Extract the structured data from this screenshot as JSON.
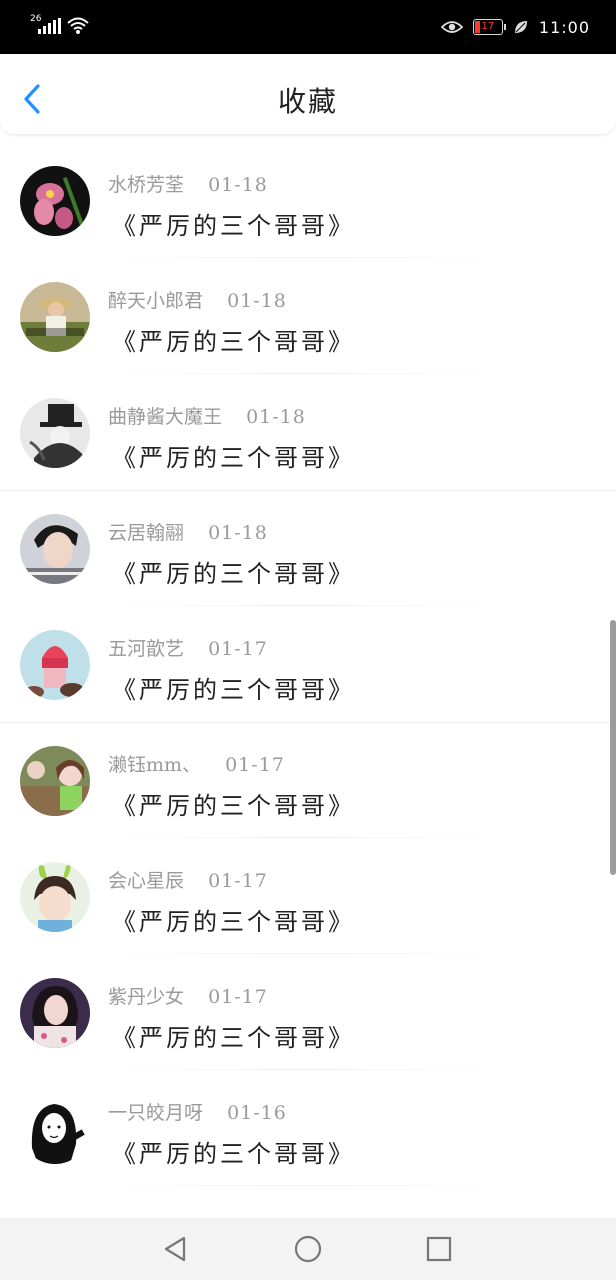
{
  "status_bar": {
    "network": "26",
    "battery": "17",
    "time": "11:00"
  },
  "header": {
    "title": "收藏"
  },
  "favorites": [
    {
      "name": "水桥芳荃",
      "date": "01-18",
      "work": "《严厉的三个哥哥》",
      "avatar": "orchid-flower"
    },
    {
      "name": "醉天小郎君",
      "date": "01-18",
      "work": "《严厉的三个哥哥》",
      "avatar": "field-hat-girl"
    },
    {
      "name": "曲静酱大魔王",
      "date": "01-18",
      "work": "《严厉的三个哥哥》",
      "avatar": "bw-top-hat"
    },
    {
      "name": "云居翰翮",
      "date": "01-18",
      "work": "《严厉的三个哥哥》",
      "avatar": "boy-portrait"
    },
    {
      "name": "五河歆艺",
      "date": "01-17",
      "work": "《严厉的三个哥哥》",
      "avatar": "ice-cream"
    },
    {
      "name": "濑钰mm、",
      "date": "01-17",
      "work": "《严厉的三个哥哥》",
      "avatar": "girl-market"
    },
    {
      "name": "会心星辰",
      "date": "01-17",
      "work": "《严厉的三个哥哥》",
      "avatar": "child-bunny"
    },
    {
      "name": "紫丹少女",
      "date": "01-17",
      "work": "《严厉的三个哥哥》",
      "avatar": "woman-floral"
    },
    {
      "name": "一只皎月呀",
      "date": "01-16",
      "work": "《严厉的三个哥哥》",
      "avatar": "sketch-girl"
    }
  ],
  "nav": {
    "back": "back-triangle-icon",
    "home": "home-circle-icon",
    "recent": "recent-square-icon"
  }
}
